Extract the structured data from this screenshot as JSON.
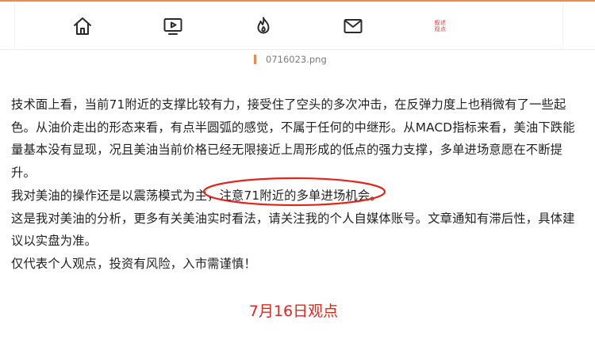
{
  "nav": {
    "items": [
      {
        "id": "home",
        "icon": "home-icon"
      },
      {
        "id": "video",
        "icon": "video-play-icon"
      },
      {
        "id": "hot",
        "icon": "flame-icon"
      },
      {
        "id": "mail",
        "icon": "mail-icon"
      },
      {
        "id": "logo",
        "icon": "site-logo",
        "logo_text_line1": "叙述",
        "logo_text_line2": "观点"
      }
    ],
    "accent_color": "#f08a4b"
  },
  "image_caption": "0716023.png",
  "article": {
    "paragraphs": [
      "技术面上看，当前71附近的支撑比较有力，接受住了空头的多次冲击，在反弹力度上也稍微有了一些起色。从油价走出的形态来看，有点半圆弧的感觉，不属于任何的中继形。从MACD指标来看，美油下跌能量基本没有显现，况且美油当前价格已经无限接近上周形成的低点的强力支撑，多单进场意愿在不断提升。",
      "我对美油的操作还是以震荡模式为主，注意71附近的多单进场机会。",
      "这是我对美油的分析，更多有关美油实时看法，请关注我的个人自媒体账号。文章通知有滞后性，具体建议以实盘为准。",
      "仅代表个人观点，投资有风险，入市需谨慎！"
    ],
    "annotation_color": "#e0261b"
  },
  "section_heading": "7月16日观点"
}
